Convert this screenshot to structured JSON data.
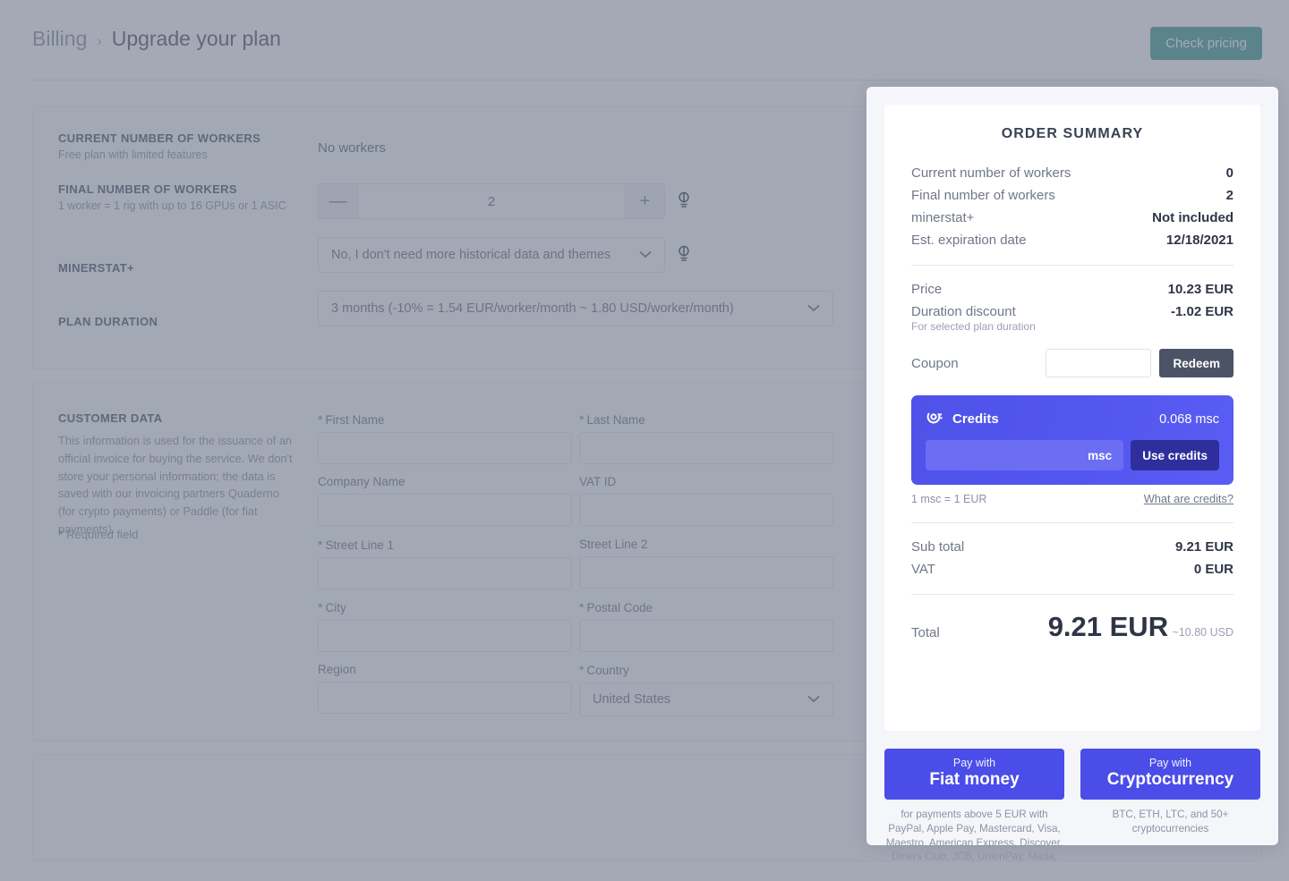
{
  "header": {
    "breadcrumb_root": "Billing",
    "breadcrumb_sep": "›",
    "breadcrumb_current": "Upgrade your plan",
    "check_pricing_label": "Check pricing"
  },
  "plan_section": {
    "current_workers": {
      "title": "CURRENT NUMBER OF WORKERS",
      "subtitle": "Free plan with limited features",
      "value": "No workers"
    },
    "final_workers": {
      "title": "FINAL NUMBER OF WORKERS",
      "subtitle": "1 worker = 1 rig with up to 16 GPUs or 1 ASIC",
      "minus": "—",
      "plus": "+",
      "value": "2"
    },
    "minerstat_plus": {
      "title": "MINERSTAT+",
      "selected": "No, I don't need more historical data and themes"
    },
    "plan_duration": {
      "title": "PLAN DURATION",
      "selected": "3 months (-10% = 1.54 EUR/worker/month ~ 1.80 USD/worker/month)"
    }
  },
  "customer_section": {
    "title": "CUSTOMER DATA",
    "description": "This information is used for the issuance of an official invoice for buying the service. We don't store your personal information; the data is saved with our invoicing partners Quaderno (for crypto payments) or Paddle (for fiat payments).",
    "required_note": "Required field",
    "fields": [
      {
        "label": "First Name",
        "required": true,
        "value": ""
      },
      {
        "label": "Last Name",
        "required": true,
        "value": ""
      },
      {
        "label": "Company Name",
        "required": false,
        "value": ""
      },
      {
        "label": "VAT ID",
        "required": false,
        "value": ""
      },
      {
        "label": "Street Line 1",
        "required": true,
        "value": ""
      },
      {
        "label": "Street Line 2",
        "required": false,
        "value": ""
      },
      {
        "label": "City",
        "required": true,
        "value": ""
      },
      {
        "label": "Postal Code",
        "required": true,
        "value": ""
      },
      {
        "label": "Region",
        "required": false,
        "value": ""
      }
    ],
    "country": {
      "label": "Country",
      "required": true,
      "selected": "United States"
    }
  },
  "order_summary": {
    "title": "ORDER SUMMARY",
    "lines": [
      {
        "label": "Current number of workers",
        "value": "0"
      },
      {
        "label": "Final number of workers",
        "value": "2"
      },
      {
        "label": "minerstat+",
        "value": "Not included"
      },
      {
        "label": "Est. expiration date",
        "value": "12/18/2021"
      }
    ],
    "price": {
      "label": "Price",
      "value": "10.23 EUR"
    },
    "discount": {
      "label": "Duration discount",
      "sublabel": "For selected plan duration",
      "value": "-1.02 EUR"
    },
    "coupon": {
      "label": "Coupon",
      "input_value": "",
      "placeholder": "",
      "redeem_label": "Redeem"
    },
    "credits": {
      "icon": "minerstat-credits-icon",
      "title": "Credits",
      "amount": "0.068 msc",
      "input_value": "",
      "placeholder": "",
      "unit": "msc",
      "use_label": "Use credits",
      "rate_note": "1 msc = 1 EUR",
      "help_link": "What are credits?"
    },
    "subtotal": {
      "label": "Sub total",
      "value": "9.21 EUR"
    },
    "vat": {
      "label": "VAT",
      "value": "0 EUR"
    },
    "total": {
      "label": "Total",
      "value": "9.21 EUR",
      "approx": "~10.80 USD"
    }
  },
  "payment": {
    "fiat": {
      "small": "Pay with",
      "big": "Fiat money",
      "note": "for payments above 5 EUR with PayPal, Apple Pay, Mastercard, Visa, Maestro, American Express, Discover, Diners Club, JCB, UnionPay, Mada,"
    },
    "crypto": {
      "small": "Pay with",
      "big": "Cryptocurrency",
      "note": "BTC, ETH, LTC, and 50+ cryptocurrencies"
    }
  },
  "colors": {
    "accent_green": "#3f9e8e",
    "brand_blue": "#4a4de8",
    "credits_dark": "#2e2f9c",
    "redeem_dark": "#4c5366",
    "overlay": "#6c7587"
  }
}
